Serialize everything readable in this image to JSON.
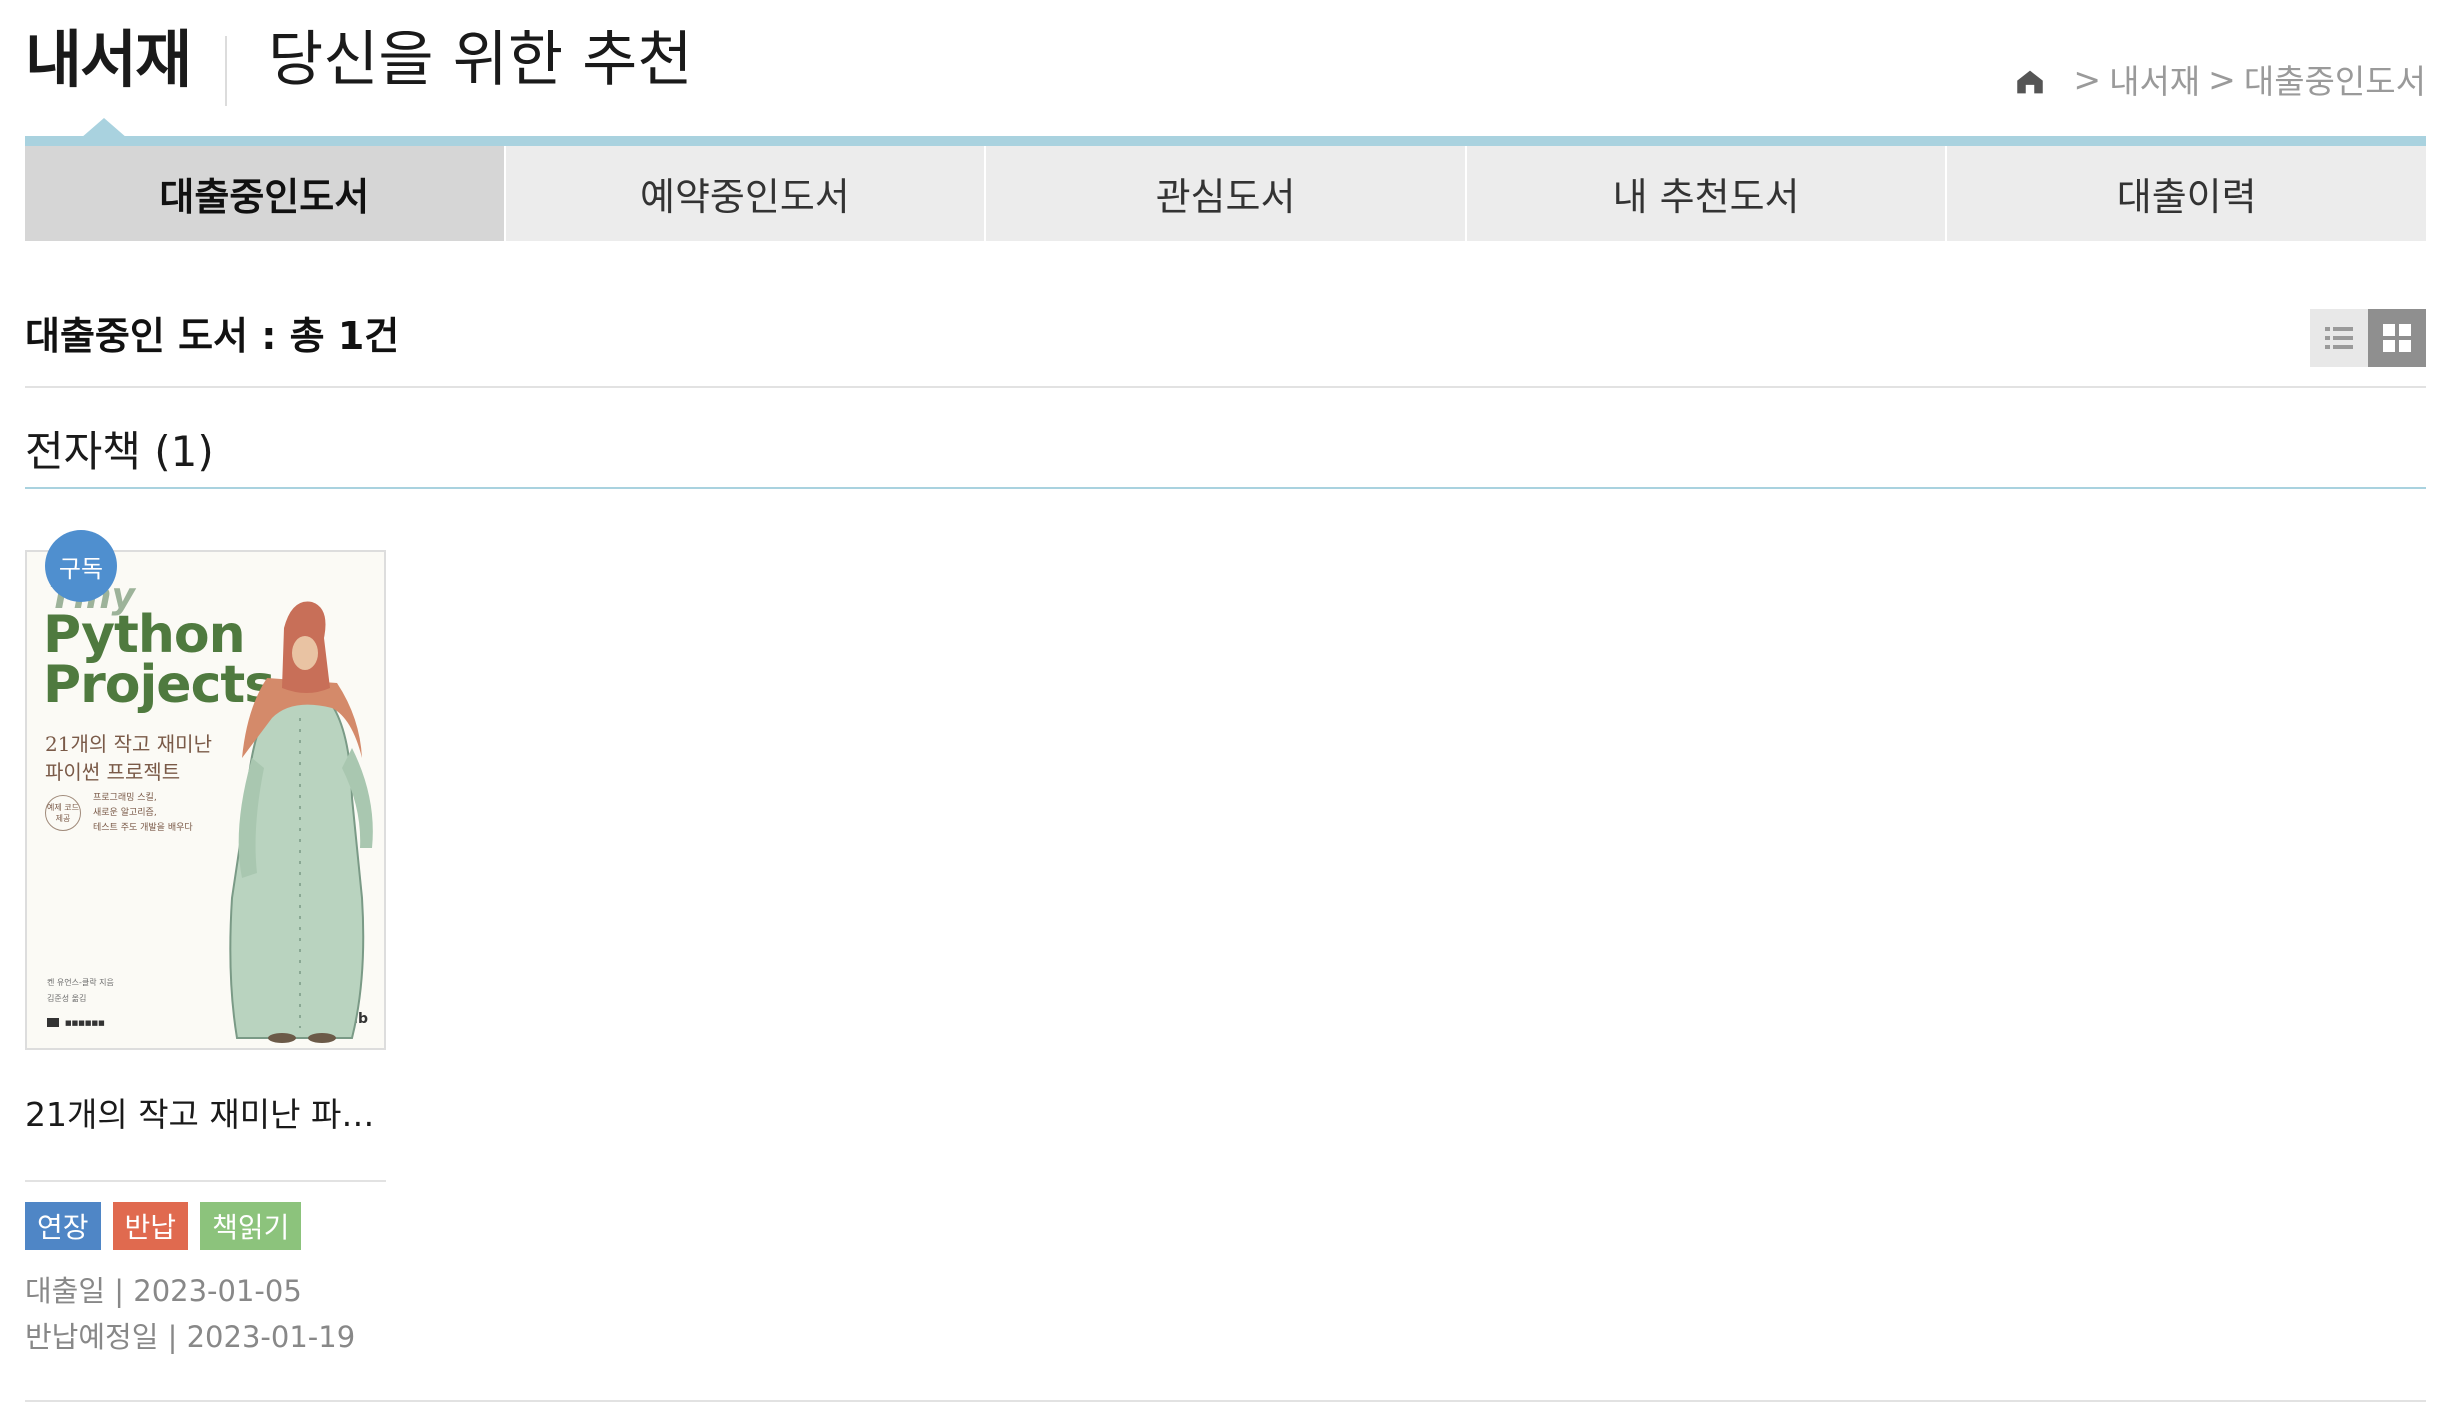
{
  "header": {
    "site_title": "내서재",
    "recommend_link": "당신을 위한 추천",
    "breadcrumb": [
      {
        "sep": ">",
        "label": "내서재"
      },
      {
        "sep": ">",
        "label": "대출중인도서"
      }
    ]
  },
  "tabs": [
    {
      "label": "대출중인도서",
      "active": true
    },
    {
      "label": "예약중인도서",
      "active": false
    },
    {
      "label": "관심도서",
      "active": false
    },
    {
      "label": "내 추천도서",
      "active": false
    },
    {
      "label": "대출이력",
      "active": false
    }
  ],
  "content": {
    "count_heading": "대출중인 도서 : 총 1건",
    "section_heading": "전자책 (1)",
    "view_modes": {
      "list": "list-view-icon",
      "grid": "grid-view-icon",
      "selected": "grid"
    }
  },
  "book": {
    "badge": "구독",
    "cover": {
      "tiny": "Tiny",
      "title_lines": [
        "Python",
        "Projects"
      ],
      "subtitle_lines": [
        "21개의 작고 재미난",
        "파이썬 프로젝트"
      ],
      "round_badge": "예제 코드 제공",
      "desc_lines": [
        "프로그래밍 스킬,",
        "새로운 알고리즘,",
        "테스트 주도 개발을 배우다"
      ],
      "author_lines": [
        "켄 유언스-클락 지음",
        "김준성 옮김"
      ],
      "imprint": "■■■■■■",
      "publisher_logo": "Jpub"
    },
    "title": "21개의 작고 재미난 파이썬 프로젝트",
    "actions": {
      "extend": "연장",
      "return": "반납",
      "read": "책읽기"
    },
    "loan_date_label": "대출일 | 2023-01-05",
    "due_date_label": "반납예정일 | 2023-01-19"
  },
  "colors": {
    "accent_line": "#a9d2df",
    "badge_blue": "#4f8fcf",
    "extend": "#4f86c6",
    "return": "#e06a4f",
    "read": "#8cc37c"
  }
}
